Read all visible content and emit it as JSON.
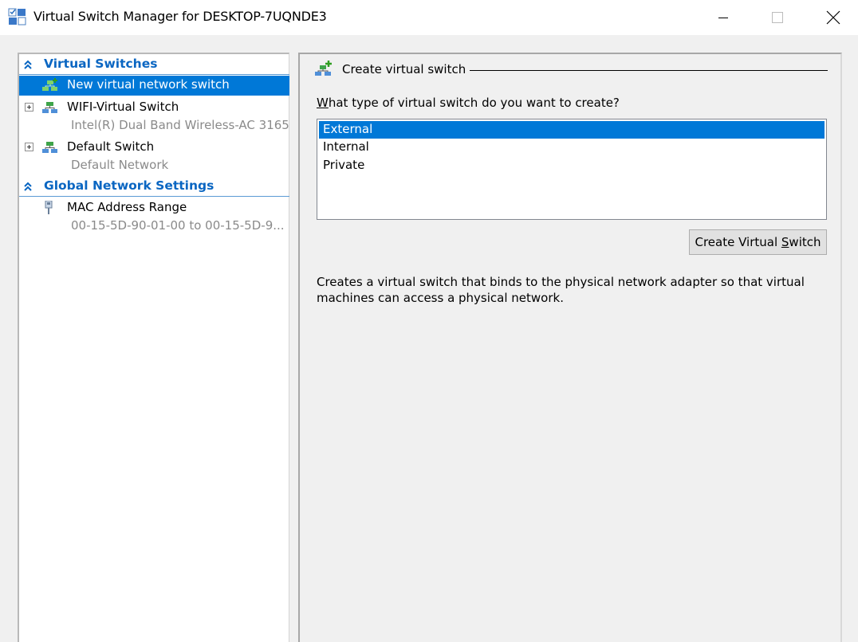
{
  "window": {
    "title": "Virtual Switch Manager for DESKTOP-7UQNDE3",
    "icon": "switch-manager-icon",
    "controls": {
      "minimize": "minimize-icon",
      "maximize": "maximize-icon",
      "close": "close-icon"
    }
  },
  "sidebar": {
    "sections": [
      {
        "label": "Virtual Switches",
        "icon": "double-chevron-up-icon",
        "items": [
          {
            "label": "New virtual network switch",
            "selected": true,
            "icon": "new-switch-icon"
          },
          {
            "label": "WIFI-Virtual Switch",
            "sublabel": "Intel(R) Dual Band Wireless-AC 3165",
            "expandable": true,
            "icon": "network-switch-icon"
          },
          {
            "label": "Default Switch",
            "sublabel": "Default Network",
            "expandable": true,
            "icon": "network-switch-icon"
          }
        ]
      },
      {
        "label": "Global Network Settings",
        "icon": "double-chevron-up-icon",
        "items": [
          {
            "label": "MAC Address Range",
            "sublabel": "00-15-5D-90-01-00 to 00-15-5D-9...",
            "icon": "network-cable-icon"
          }
        ]
      }
    ]
  },
  "main": {
    "group_title": "Create virtual switch",
    "question_accel": "W",
    "question_rest": "hat type of virtual switch do you want to create?",
    "options": [
      "External",
      "Internal",
      "Private"
    ],
    "selected_option": "External",
    "create_button_pre": "Create Virtual ",
    "create_button_accel": "S",
    "create_button_post": "witch",
    "description": "Creates a virtual switch that binds to the physical network adapter so that virtual machines can access a physical network."
  },
  "colors": {
    "selection": "#0078d7",
    "section_header": "#0a66c2",
    "sublabel": "#8a8a8a"
  }
}
